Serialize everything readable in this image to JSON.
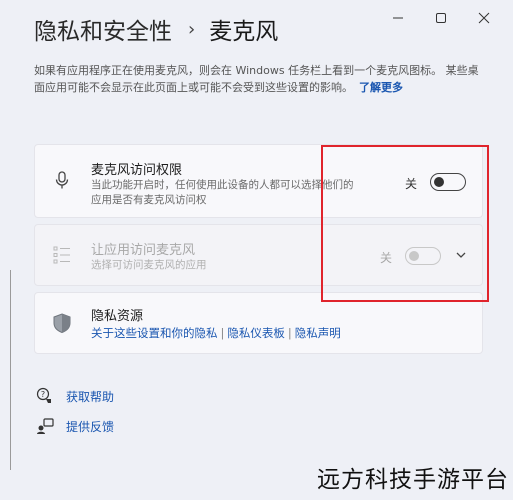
{
  "window": {
    "breadcrumb_parent": "隐私和安全性",
    "breadcrumb_separator": "›",
    "page_title": "麦克风"
  },
  "description": {
    "text": "如果有应用程序正在使用麦克风，则会在 Windows 任务栏上看到一个麦克风图标。 某些桌面应用可能不会显示在此页面上或可能不会受到这些设置的影响。",
    "learn_more": "了解更多"
  },
  "settings": {
    "mic_access": {
      "title": "麦克风访问权限",
      "subtitle": "当此功能开启时，任何使用此设备的人都可以选择他们的应用是否有麦克风访问权",
      "toggle_label": "关",
      "on": false
    },
    "app_access": {
      "title": "让应用访问麦克风",
      "subtitle": "选择可访问麦克风的应用",
      "toggle_label": "关",
      "on": false,
      "enabled": false
    },
    "privacy": {
      "title": "隐私资源",
      "links": [
        "关于这些设置和你的隐私",
        "隐私仪表板",
        "隐私声明"
      ],
      "separator": "|"
    }
  },
  "footer": {
    "help": "获取帮助",
    "feedback": "提供反馈"
  },
  "watermark": "远方科技手游平台",
  "colors": {
    "accent_link": "#1a56b0",
    "highlight_box": "#e0242c"
  }
}
